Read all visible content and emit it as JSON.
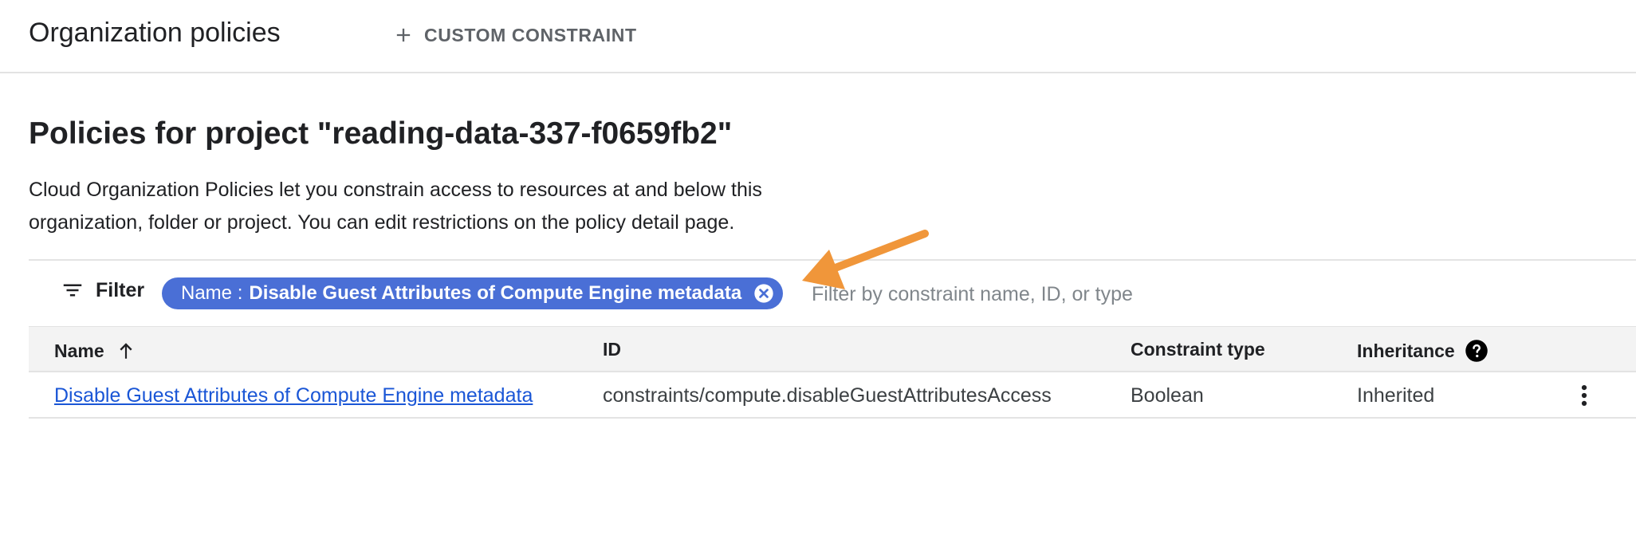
{
  "header": {
    "title": "Organization policies",
    "custom_constraint_label": "CUSTOM CONSTRAINT"
  },
  "page": {
    "heading": "Policies for project \"reading-data-337-f0659fb2\"",
    "description": "Cloud Organization Policies let you constrain access to resources at and below this organization, folder or project. You can edit restrictions on the policy detail page."
  },
  "filter": {
    "label": "Filter",
    "chip_key": "Name :",
    "chip_value": "Disable Guest Attributes of Compute Engine metadata",
    "placeholder": "Filter by constraint name, ID, or type"
  },
  "table": {
    "columns": {
      "name": "Name",
      "id": "ID",
      "type": "Constraint type",
      "inheritance": "Inheritance"
    },
    "rows": [
      {
        "name": "Disable Guest Attributes of Compute Engine metadata",
        "id": "constraints/compute.disableGuestAttributesAccess",
        "type": "Boolean",
        "inheritance": "Inherited"
      }
    ]
  },
  "colors": {
    "chip_bg": "#4a6fd6",
    "link": "#1a56d6",
    "annotation_arrow": "#f0963a"
  },
  "icons": {
    "plus": "plus-icon",
    "filter": "filter-lines-icon",
    "chip_close": "close-circle-icon",
    "sort": "arrow-up-icon",
    "help": "help-circle-icon",
    "more": "more-vert-icon"
  }
}
